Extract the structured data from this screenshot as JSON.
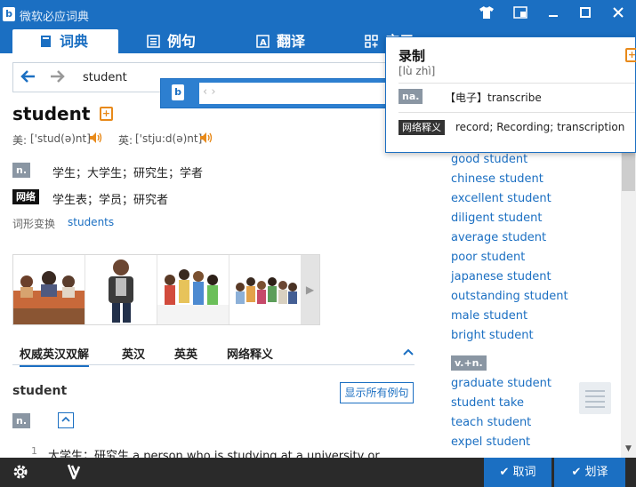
{
  "app": {
    "title": "微软必应词典"
  },
  "tabs": [
    {
      "label": "词典"
    },
    {
      "label": "例句"
    },
    {
      "label": "翻译"
    },
    {
      "label": "应用"
    }
  ],
  "search": {
    "value": "student"
  },
  "entry": {
    "word": "student",
    "us_label": "美:",
    "us_phonetic": "['stud(ə)nt]",
    "uk_label": "英:",
    "uk_phonetic": "['stju:d(ə)nt]",
    "definitions": [
      {
        "pos": "n.",
        "text": "学生；大学生；研究生；学者"
      },
      {
        "pos": "网络",
        "text": "学生表；学员；研究者"
      }
    ],
    "inflection_label": "词形变换",
    "inflection_value": "students"
  },
  "subtabs": [
    "权威英汉双解",
    "英汉",
    "英英",
    "网络释义"
  ],
  "sense": {
    "word": "student",
    "show_all": "显示所有例句",
    "pos": "n.",
    "number": "1",
    "text": "大学生；研究生 a person who is studying at a university or"
  },
  "collocations": {
    "items": [
      "good student",
      "chinese student",
      "excellent student",
      "diligent student",
      "average student",
      "poor student",
      "japanese student",
      "outstanding student",
      "male student",
      "bright student"
    ],
    "vn_label": "v.+n.",
    "vn_items": [
      "graduate student",
      "student take",
      "teach student",
      "expel student"
    ]
  },
  "popup": {
    "word": "录制",
    "pinyin": "[lù zhì]",
    "pos": "na.",
    "definition": "【电子】transcribe",
    "web_label": "网络释义",
    "web_definition": "record; Recording; transcription"
  },
  "bottom": {
    "cancel": "取词",
    "select": "划译"
  },
  "colors": {
    "accent": "#1b6fc2",
    "orange": "#e88a1a"
  }
}
